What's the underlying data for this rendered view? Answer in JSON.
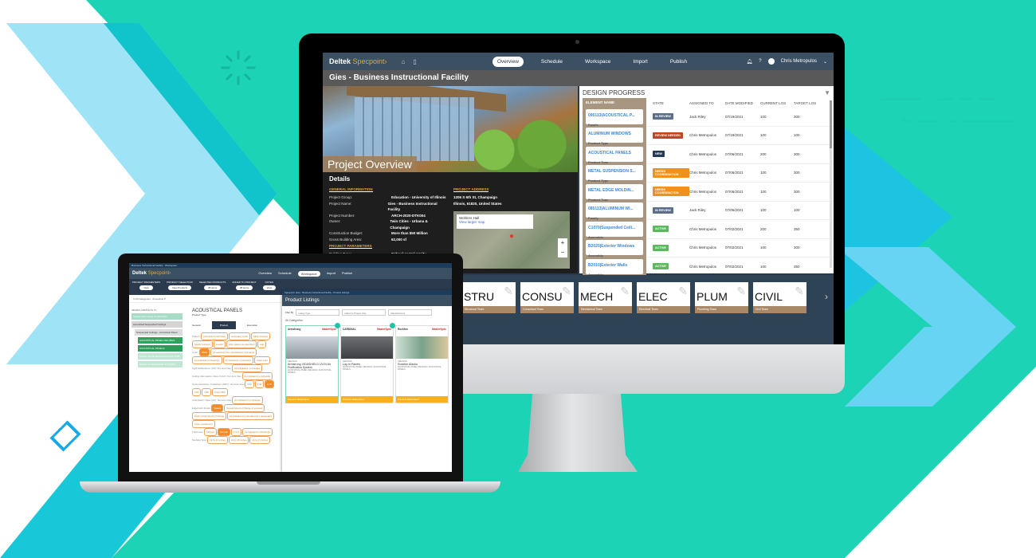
{
  "colors": {
    "teal": "#1cd3b5",
    "cyan": "#18c6e0",
    "light_blue": "#9fe3f6",
    "sky": "#66d4f2",
    "nav_dark": "#3c5063",
    "accent_orange": "#e8a33b",
    "tan": "#a89680"
  },
  "desktop": {
    "app": {
      "logo_main": "Deltek",
      "logo_accent": "Specpoint›",
      "home_icon": "home-icon",
      "map_icon": "book-icon"
    },
    "nav": {
      "tabs": [
        {
          "label": "Overview",
          "active": true
        },
        {
          "label": "Schedule",
          "active": false
        },
        {
          "label": "Workspace",
          "active": false
        },
        {
          "label": "Import",
          "active": false
        },
        {
          "label": "Publish",
          "active": false
        }
      ],
      "user": "Chris Metropulos",
      "bell_icon": "bell-icon",
      "help_icon": "help-icon"
    },
    "project_title": "Gies - Business Instructional Facility",
    "hero_title": "Project Overview",
    "details": {
      "heading": "Details",
      "general_title": "GENERAL INFORMATION",
      "general": [
        {
          "k": "Project Group:",
          "v": "Education - University of Illinois"
        },
        {
          "k": "Project Name:",
          "v": "Gies - Business Instructional Facility"
        },
        {
          "k": "Project Number:",
          "v": "ARCH-2020-DTK004"
        },
        {
          "k": "Owner:",
          "v": "Twin Cities - Urbana & Champaign"
        },
        {
          "k": "Construction Budget:",
          "v": "More than $50 Million"
        },
        {
          "k": "Gross Building Area:",
          "v": "62,000 sf"
        }
      ],
      "params_title": "PROJECT PARAMETERS",
      "params": [
        {
          "k": "Building Type:",
          "v": "School or University"
        }
      ],
      "address_title": "PROJECT ADDRESS",
      "address_line1": "1206 S 6th St, Champaign",
      "address_line2": "Illinois, 61820, United States",
      "map": {
        "place": "Wohlers Hall",
        "link": "View larger map",
        "zoom_in": "+",
        "zoom_out": "−"
      }
    },
    "design_progress": {
      "title": "DESIGN PROGRESS",
      "columns": [
        "ELEMENT NAME",
        "STATE",
        "ASSIGNED TO",
        "DATE MODIFIED",
        "CURRENT LOS",
        "TARGET LOS"
      ],
      "rows": [
        {
          "name": "095113|ACOUSTICAL P...",
          "type": "Family",
          "state": "IN REVIEW",
          "state_color": "#5b6f8a",
          "assigned": "Jack Riley",
          "date": "07/19/2021",
          "current": "100",
          "target": "300"
        },
        {
          "name": "ALUMINUM WINDOWS",
          "type": "Product Type",
          "state": "REVIEW NEEDED",
          "state_color": "#c0461f",
          "assigned": "Chris Metropulos",
          "date": "07/19/2021",
          "current": "100",
          "target": "100"
        },
        {
          "name": "ACOUSTICAL PANELS",
          "type": "Product Type",
          "state": "NEW",
          "state_color": "#243b55",
          "assigned": "Chris Metropulos",
          "date": "07/06/2021",
          "current": "200",
          "target": "300"
        },
        {
          "name": "METAL SUSPENSION S...",
          "type": "Product Type",
          "state": "NEEDS COORDINATION",
          "state_color": "#f0911e",
          "assigned": "Chris Metropulos",
          "date": "07/06/2021",
          "current": "100",
          "target": "300"
        },
        {
          "name": "METAL EDGE MOLDIN...",
          "type": "Product Type",
          "state": "NEEDS COORDINATION",
          "state_color": "#f0911e",
          "assigned": "Chris Metropulos",
          "date": "07/06/2021",
          "current": "100",
          "target": "300"
        },
        {
          "name": "085113|ALUMINUM WI...",
          "type": "Family",
          "state": "IN REVIEW",
          "state_color": "#5b6f8a",
          "assigned": "Jack Riley",
          "date": "07/06/2021",
          "current": "100",
          "target": "100"
        },
        {
          "name": "C1070|Suspended Ceili...",
          "type": "Assembly",
          "state": "ACTIVE",
          "state_color": "#5cb85c",
          "assigned": "Chris Metropulos",
          "date": "07/02/2021",
          "current": "200",
          "target": "350"
        },
        {
          "name": "B2020|Exterior Windows",
          "type": "Assembly",
          "state": "ACTIVE",
          "state_color": "#5cb85c",
          "assigned": "Chris Metropulos",
          "date": "07/02/2021",
          "current": "100",
          "target": "300"
        },
        {
          "name": "B2010|Exterior Walls",
          "type": "Assembly",
          "state": "ACTIVE",
          "state_color": "#5cb85c",
          "assigned": "Chris Metropulos",
          "date": "07/02/2021",
          "current": "100",
          "target": "350"
        }
      ]
    },
    "teams": [
      {
        "abbr": "STRU",
        "name": "Structural Team"
      },
      {
        "abbr": "CONSU",
        "name": "Consultant Team"
      },
      {
        "abbr": "MECH",
        "name": "Mechanical Team"
      },
      {
        "abbr": "ELEC",
        "name": "Electrical Team"
      },
      {
        "abbr": "PLUM",
        "name": "Plumbing Team"
      },
      {
        "abbr": "CIVIL",
        "name": "Civil Team"
      }
    ],
    "teams_next": "›"
  },
  "laptop": {
    "window_title": "Business Instructional Facility - Workspace",
    "logo_main": "Deltek",
    "logo_accent": "Specpoint›",
    "tabs": [
      {
        "label": "Overview",
        "active": false
      },
      {
        "label": "Schedule",
        "active": false
      },
      {
        "label": "Workspace",
        "active": true
      },
      {
        "label": "Import",
        "active": false
      },
      {
        "label": "Publish",
        "active": false
      }
    ],
    "toolbar": [
      {
        "label": "PROJECT PARAMETERS",
        "button": "View"
      },
      {
        "label": "PRODUCT SELECTION",
        "button": "View Products"
      },
      {
        "label": "SELECTED PRODUCTS",
        "button": "38 items"
      },
      {
        "label": "ADDED TO PROJECT",
        "button": "38 items"
      },
      {
        "label": "NOTES",
        "button": "View"
      }
    ],
    "search_crumb": "In All Categories · Acoustical P",
    "search_results": "SEARCH RESULTS (7)",
    "tree": [
      {
        "label": "Suspended Ceiling Construction",
        "color": "#a8dcc6"
      },
      {
        "label": "Acoustical Suspended Ceilings",
        "color": "#d4d4d4"
      },
      {
        "label": "Suspended Ceilings - Acoustical Panel",
        "color": "#dcdcdc"
      },
      {
        "label": "ACOUSTICAL PANEL CEILINGS",
        "color": "#2fa35e"
      },
      {
        "label": "ACOUSTICAL PANELS",
        "color": "#2f9a58"
      },
      {
        "label": "METAL EDGE MOLDINGS AND TRIM",
        "color": "#bfe6d2"
      },
      {
        "label": "METAL SUSPENSION SYSTEMS",
        "color": "#bfe6d2"
      }
    ],
    "main_title": "ACOUSTICAL PANELS",
    "main_subtitle": "Product Type",
    "main_tabs": [
      "General",
      "Product",
      "Execution"
    ],
    "spec_lines": [
      {
        "label": "Pattern:",
        "chips": [
          "perforated small holes",
          "perforated, small",
          "lightly textured",
          "heavily textured",
          "smooth",
          "other pattern as described",
          "and"
        ]
      },
      {
        "label": "Color:",
        "chips": [
          "White",
          "As selected from manufacturer's full range",
          "As indicated on Drawings",
          "As indicated in a schedule",
          "Insert color"
        ]
      },
      {
        "label": "Light Reflectance (LR): Not less than",
        "chips": [
          "As indicated in a schedule"
        ]
      },
      {
        "label": "Ceiling Attenuation Class (CAC): Not less than",
        "chips": [
          "As indicated in a schedule"
        ]
      },
      {
        "label": "Noise Reduction Coefficient (NRC): Not less than",
        "chips": [
          "0.50",
          "0.60",
          "0.70",
          "0.80",
          "0.90",
          "Insert NRC"
        ]
      },
      {
        "label": "Articulation Class (AC): Not less than",
        "chips": [
          "As indicated in a schedule"
        ]
      },
      {
        "label": "Edge/Joint Detail:",
        "chips": [
          "Square",
          "Reveal sized to fit flange of exposed",
          "Flush reveal sized to fit flange",
          "As indicated by manufacturer's designation",
          "Insert requirement"
        ]
      },
      {
        "label": "Thickness:",
        "chips": [
          "5/8 inch",
          "3/4 inch",
          "1 inch",
          "As indicated on Drawings"
        ]
      },
      {
        "label": "Modular Size:",
        "chips": [
          "24 by 24 inches",
          "24 by 48 inches",
          "24 by 72 inches"
        ]
      }
    ],
    "product_listings": {
      "window_title": "Specpoint: Gies - Business Instructional Facility - Product Listings",
      "title": "Product Listings",
      "filter_label": "Filter By",
      "filters": [
        "Listing Type",
        "Added to Project Only",
        "Manufacturers"
      ],
      "category": "All Categories",
      "cards": [
        {
          "brand": "Armstrong",
          "master": "MasterSpec",
          "division": "CEILINGS",
          "name": "Armstrong VIDASHIELD UV24 Air Purification System",
          "tags": "ACOUSTICAL PANEL CEILINGS / ACOUSTICAL PANELS",
          "footer": "Premium MasterSpec"
        },
        {
          "brand": "CARDINAL",
          "master": "MasterSpec",
          "division": "CEILINGS",
          "name": "Lay-In Panels",
          "tags": "ACOUSTICAL PANEL CEILINGS / ACOUSTICAL PANELS",
          "footer": "Premium MasterSpec"
        },
        {
          "brand": "Rockfon",
          "master": "MasterSpec",
          "division": "CEILINGS",
          "name": "Rockfon Alaska",
          "tags": "ACOUSTICAL PANEL CEILINGS / ACOUSTICAL PANELS",
          "footer": "Premium MasterSpec"
        }
      ]
    }
  }
}
